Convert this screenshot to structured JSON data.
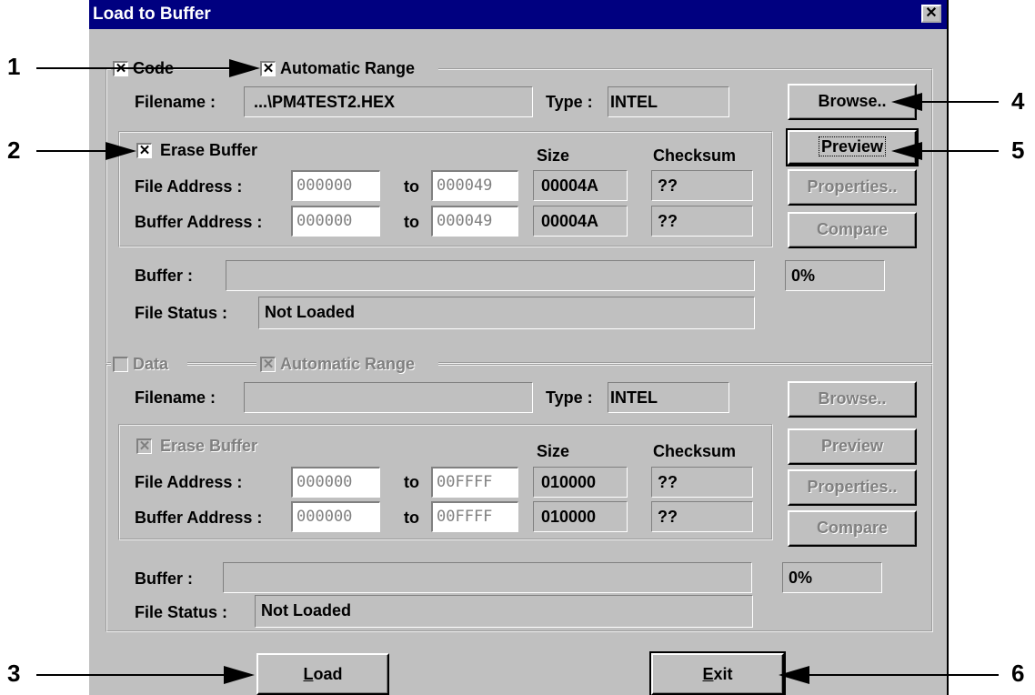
{
  "window": {
    "title": "Load to Buffer",
    "close_glyph": "✕"
  },
  "code": {
    "group_label": "Code",
    "checked": "✕",
    "auto_range_label": "Automatic Range",
    "filename_label": "Filename :",
    "filename_value": "...\\PM4TEST2.HEX",
    "type_label": "Type :",
    "type_value": "INTEL",
    "erase_label": "Erase Buffer",
    "size_header": "Size",
    "checksum_header": "Checksum",
    "file_addr_label": "File Address :",
    "buffer_addr_label": "Buffer Address :",
    "to_label": "to",
    "file_from": "000000",
    "file_to": "000049",
    "file_size": "00004A",
    "file_checksum": "??",
    "buf_from": "000000",
    "buf_to": "000049",
    "buf_size": "00004A",
    "buf_checksum": "??",
    "buffer_label": "Buffer :",
    "percent": "0%",
    "status_label": "File Status :",
    "status_value": "Not Loaded",
    "browse": "Browse..",
    "preview": "Preview",
    "properties": "Properties..",
    "compare": "Compare"
  },
  "data": {
    "group_label": "Data",
    "checked": "✕",
    "auto_range_label": "Automatic Range",
    "filename_label": "Filename :",
    "filename_value": "",
    "type_label": "Type :",
    "type_value": "INTEL",
    "erase_label": "Erase Buffer",
    "size_header": "Size",
    "checksum_header": "Checksum",
    "file_addr_label": "File Address :",
    "buffer_addr_label": "Buffer Address :",
    "to_label": "to",
    "file_from": "000000",
    "file_to": "00FFFF",
    "file_size": "010000",
    "file_checksum": "??",
    "buf_from": "000000",
    "buf_to": "00FFFF",
    "buf_size": "010000",
    "buf_checksum": "??",
    "buffer_label": "Buffer :",
    "percent": "0%",
    "status_label": "File Status :",
    "status_value": "Not Loaded",
    "browse": "Browse..",
    "preview": "Preview",
    "properties": "Properties..",
    "compare": "Compare"
  },
  "footer": {
    "load_mnemonic": "L",
    "load_rest": "oad",
    "exit_mnemonic": "E",
    "exit_rest": "xit"
  },
  "callouts": [
    "1",
    "2",
    "3",
    "4",
    "5",
    "6"
  ]
}
